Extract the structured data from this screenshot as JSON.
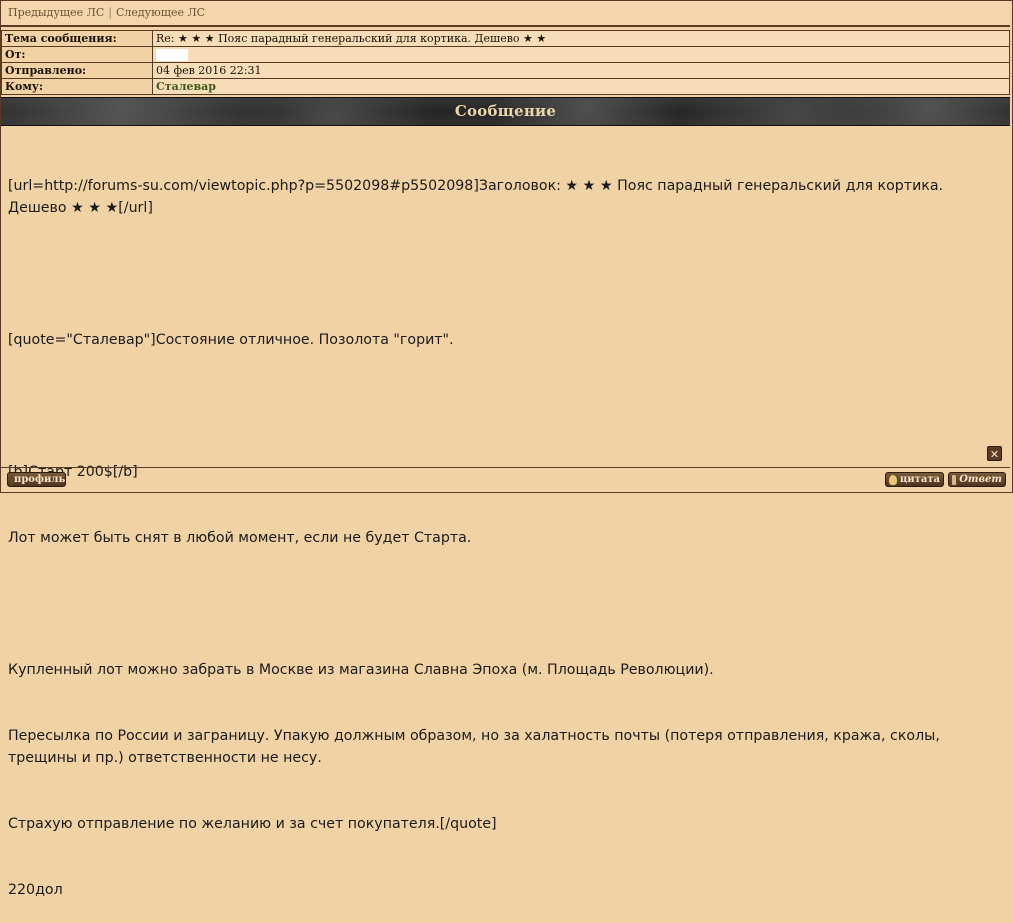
{
  "nav": {
    "prev": "Предыдущее ЛС",
    "separator": "|",
    "next": "Следующее ЛС"
  },
  "header": {
    "rows": [
      {
        "label": "Тема сообщения:",
        "value": "Re: ★ ★ ★ Пояс парадный генеральский для кортика. Дешево ★ ★"
      },
      {
        "label": "От:",
        "value": ""
      },
      {
        "label": "Отправлено:",
        "value": "04 фев 2016 22:31"
      },
      {
        "label": "Кому:",
        "value": "Сталевар"
      }
    ]
  },
  "section_title": "Сообщение",
  "message": {
    "lines": [
      "[url=http://forums-su.com/viewtopic.php?p=5502098#p5502098]Заголовок: ★ ★ ★ Пояс парадный генеральский для кортика. Дешево ★ ★ ★[/url]",
      "",
      "[quote=\"Сталевар\"]Состояние отличное. Позолота \"горит\".",
      "",
      "[b]Старт 200$[/b]",
      "Лот может быть снят в любой момент, если не будет Старта.",
      "",
      "Купленный лот можно забрать в Москве из магазина Славна Эпоха (м. Площадь Революции).",
      "Пересылка по России и заграницу. Упакую должным образом, но за халатность почты (потеря отправления, кража, сколы, трещины и пр.) ответственности не несу.",
      "Страхую отправление по желанию и за счет покупателя.[/quote]",
      "220дол"
    ]
  },
  "buttons": {
    "close": "✕",
    "profile": "профиль",
    "quote": "цитата",
    "reply": "Ответ"
  },
  "colors": {
    "background": "#f1d2a4",
    "border": "#5a3a22",
    "bar": "#2e2e2e",
    "bar_text": "#ead6a8",
    "recipient": "#3e5a1a"
  }
}
